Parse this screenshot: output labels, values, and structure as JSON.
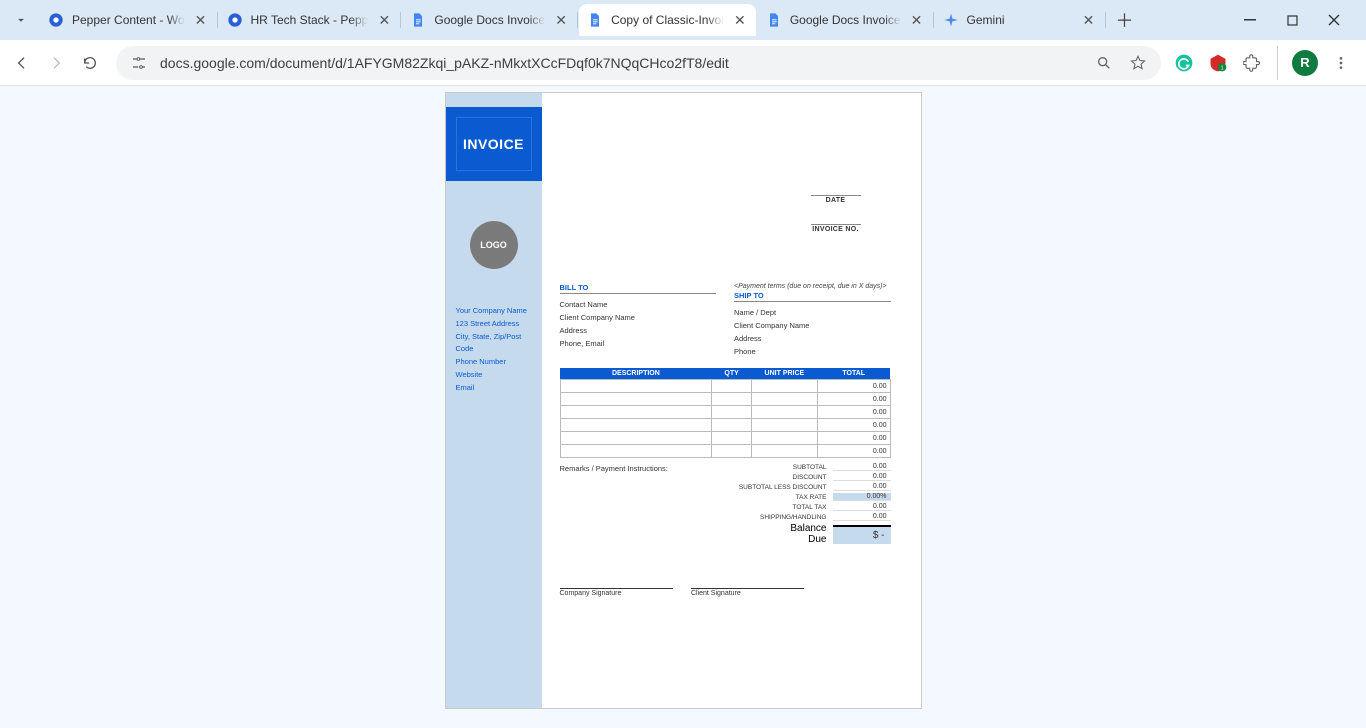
{
  "tabs": [
    {
      "title": "Pepper Content - Wo",
      "favicon": "pepper"
    },
    {
      "title": "HR Tech Stack - Pepp",
      "favicon": "pepper"
    },
    {
      "title": "Google Docs Invoice",
      "favicon": "docs"
    },
    {
      "title": "Copy of Classic-Invoi",
      "favicon": "docs",
      "active": true
    },
    {
      "title": "Google Docs Invoice",
      "favicon": "docs"
    },
    {
      "title": "Gemini",
      "favicon": "gemini"
    }
  ],
  "url": "docs.google.com/document/d/1AFYGM82Zkqi_pAKZ-nMkxtXCcFDqf0k7NQqCHco2fT8/edit",
  "avatar_initial": "R",
  "doc": {
    "banner": "INVOICE",
    "logo_label": "LOGO",
    "company": [
      "Your Company Name",
      "123 Street Address",
      "City, State, Zip/Post Code",
      "Phone Number",
      "Website",
      "Email"
    ],
    "header_labels": {
      "date": "DATE",
      "invoice_no": "INVOICE NO."
    },
    "bill_to_label": "BILL TO",
    "ship_to_label": "SHIP TO",
    "payment_terms_placeholder": "<Payment terms (due on receipt, due in X days)>",
    "bill_to": [
      "Contact Name",
      "Client Company Name",
      "Address",
      "Phone, Email"
    ],
    "ship_to": [
      "Name / Dept",
      "Client Company Name",
      "Address",
      "Phone"
    ],
    "table_headers": {
      "desc": "DESCRIPTION",
      "qty": "QTY",
      "unit": "UNIT PRICE",
      "total": "TOTAL"
    },
    "item_rows": [
      "0.00",
      "0.00",
      "0.00",
      "0.00",
      "0.00",
      "0.00"
    ],
    "remarks_label": "Remarks / Payment Instructions:",
    "summary": [
      {
        "label": "SUBTOTAL",
        "value": "0.00"
      },
      {
        "label": "DISCOUNT",
        "value": "0.00"
      },
      {
        "label": "SUBTOTAL LESS DISCOUNT",
        "value": "0.00"
      },
      {
        "label": "TAX RATE",
        "value": "0.00%",
        "tax": true
      },
      {
        "label": "TOTAL TAX",
        "value": "0.00"
      },
      {
        "label": "SHIPPING/HANDLING",
        "value": "0.00"
      }
    ],
    "balance_label": "Balance Due",
    "balance_value": "$ -",
    "sig_company": "Company Signature",
    "sig_client": "Client Signature"
  }
}
